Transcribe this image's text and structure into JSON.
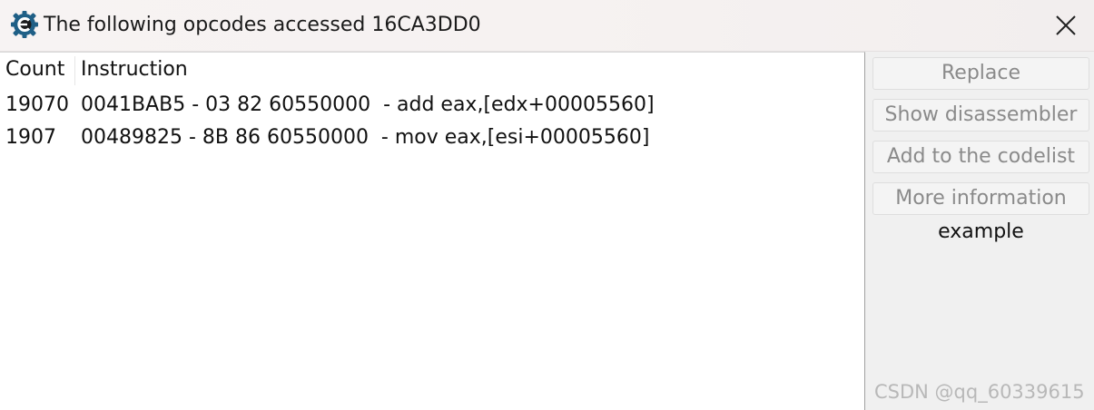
{
  "window": {
    "title": "The following opcodes accessed 16CA3DD0",
    "app_icon": "cheat-engine-icon",
    "close_icon": "close-icon"
  },
  "list": {
    "columns": [
      "Count",
      "Instruction"
    ],
    "rows": [
      {
        "count": "19070",
        "instruction": "0041BAB5 - 03 82 60550000  - add eax,[edx+00005560]"
      },
      {
        "count": "1907",
        "instruction": "00489825 - 8B 86 60550000  - mov eax,[esi+00005560]"
      }
    ]
  },
  "side": {
    "replace": "Replace",
    "show_disassembler": "Show disassembler",
    "add_codelist": "Add to the codelist",
    "more_info": "More information",
    "example": "example"
  },
  "watermark": "CSDN @qq_60339615"
}
